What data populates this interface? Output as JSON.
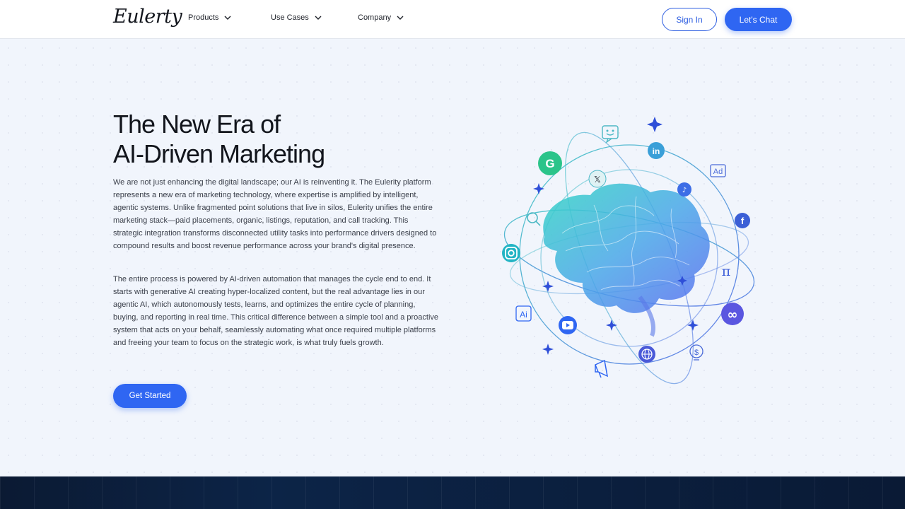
{
  "nav": {
    "logo": "Eulerty",
    "items": [
      {
        "label": "Products"
      },
      {
        "label": "Use Cases"
      },
      {
        "label": "Company"
      }
    ],
    "signin_label": "Sign In",
    "chat_label": "Let's Chat"
  },
  "hero": {
    "title_line1": "The New Era of",
    "title_line2": "AI-Driven Marketing",
    "paragraph1": "We are not just enhancing the digital landscape; our AI is reinventing it. The Eulerity platform represents a new era of marketing technology, where expertise is amplified by intelligent, agentic systems. Unlike fragmented point solutions that live in silos, Eulerity unifies the entire marketing stack—paid placements, organic, listings, reputation, and call tracking. This strategic integration transforms disconnected utility tasks into performance drivers designed to compound results and boost revenue performance across your brand's digital presence.",
    "paragraph2": "The entire process is powered by AI-driven automation that manages the cycle end to end. It starts with generative AI creating hyper-localized content, but the real advantage lies in our agentic AI, which autonomously tests, learns, and optimizes the entire cycle of planning, buying, and reporting in real time. This critical difference between a simple tool and a proactive system that acts on your behalf, seamlessly automating what once required multiple platforms and freeing your team to focus on the strategic work, is what truly fuels growth.",
    "cta_label": "Get Started"
  },
  "illustration": {
    "icons": [
      "google-icon",
      "x-icon",
      "linkedin-icon",
      "tiktok-icon",
      "facebook-icon",
      "instagram-icon",
      "meta-icon",
      "youtube-icon",
      "globe-icon",
      "chat-icon",
      "ad-icon",
      "search-icon",
      "ai-icon",
      "megaphone-icon",
      "dollar-bulb-icon",
      "pi-icon"
    ],
    "labels": {
      "google": "G",
      "x": "𝕏",
      "linkedin": "in",
      "tiktok": "♪",
      "facebook": "f",
      "meta": "∞",
      "ad": "Ad",
      "ai": "Ai",
      "pi": "π",
      "dollar": "$"
    },
    "accent": "#2f66f2",
    "teal": "#2bc4c4"
  }
}
